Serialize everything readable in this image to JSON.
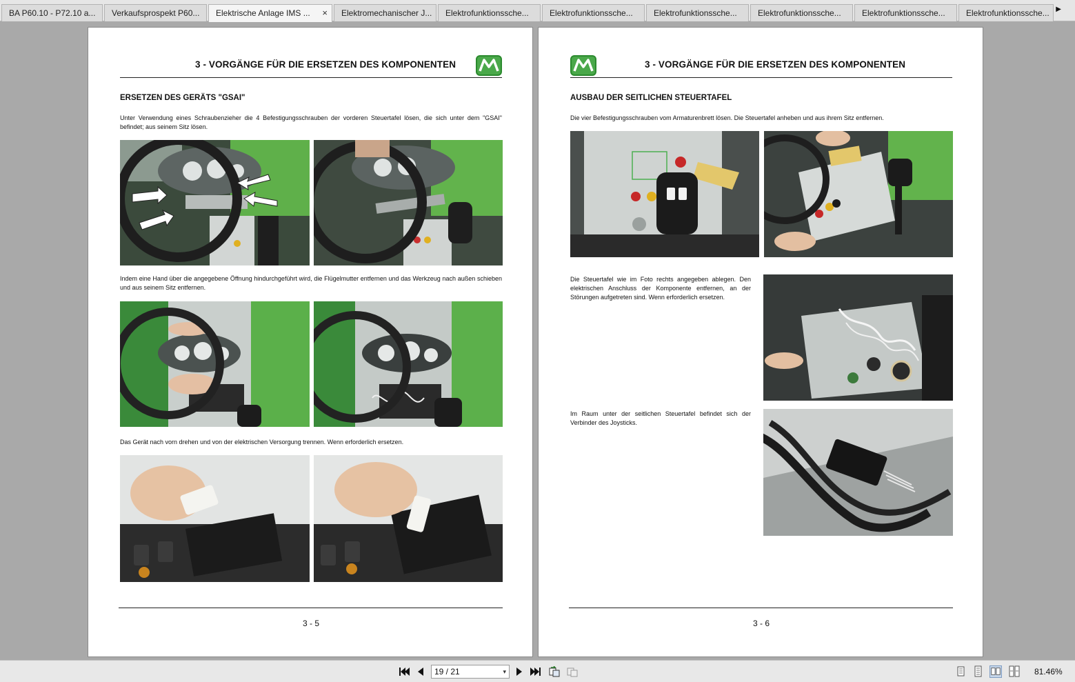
{
  "tabs": [
    {
      "label": "BA P60.10 - P72.10 a..."
    },
    {
      "label": "Verkaufsprospekt P60..."
    },
    {
      "label": "Elektrische Anlage IMS ..."
    },
    {
      "label": "Elektromechanischer J..."
    },
    {
      "label": "Elektrofunktionssche..."
    },
    {
      "label": "Elektrofunktionssche..."
    },
    {
      "label": "Elektrofunktionssche..."
    },
    {
      "label": "Elektrofunktionssche..."
    },
    {
      "label": "Elektrofunktionssche..."
    },
    {
      "label": "Elektrofunktionssche..."
    }
  ],
  "active_tab_index": 2,
  "tab_close_glyph": "×",
  "tab_scroll_glyph": "▶",
  "left_page": {
    "title": "3 - VORGÄNGE FÜR DIE ERSETZEN DES KOMPONENTEN",
    "section": "ERSETZEN DES GERÄTS \"GSAI\"",
    "para1": "Unter Verwendung eines Schraubenzieher die 4 Befestigungsschrauben der vorderen Steuertafel lösen, die sich unter dem \"GSAI\" befindet; aus seinem Sitz lösen.",
    "para2": "Indem eine Hand über die angegebene Öffnung hindurchgeführt wird, die Flügelmutter entfernen und das Werkzeug nach außen schieben und aus seinem Sitz entfernen.",
    "para3": "Das Gerät nach vorn drehen und von der elektrischen Versorgung trennen. Wenn erforderlich ersetzen.",
    "page_number": "3 - 5"
  },
  "right_page": {
    "title": "3 - VORGÄNGE FÜR DIE ERSETZEN DES KOMPONENTEN",
    "section": "AUSBAU DER SEITLICHEN STEUERTAFEL",
    "para1": "Die vier Befestigungsschrauben vom Armaturenbrett lösen. Die Steuertafel anheben und aus ihrem Sitz entfernen.",
    "para2": "Die Steuertafel wie im Foto rechts angegeben ablegen. Den elektrischen Anschluss der Komponente entfernen, an der Störungen aufgetreten sind. Wenn erforderlich ersetzen.",
    "para3": "Im Raum unter der seitlichen Steuertafel befindet sich der Verbinder des Joysticks.",
    "page_number": "3 - 6"
  },
  "toolbar": {
    "page_indicator": "19 / 21",
    "dropdown_glyph": "▾",
    "zoom": "81.46%"
  },
  "colors": {
    "brand_green": "#4aa84a",
    "viewer_bg": "#a9a9a9"
  }
}
